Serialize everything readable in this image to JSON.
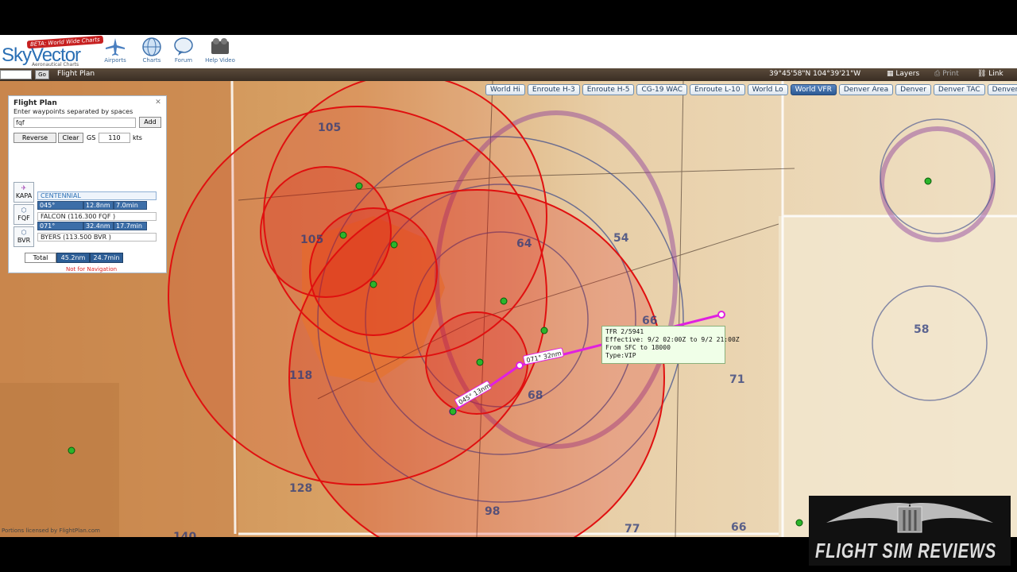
{
  "header": {
    "logo_text": "SkyVector",
    "logo_sub": "Aeronautical Charts",
    "beta_badge": "BETA: World Wide Charts",
    "nav": [
      {
        "label": "Airports"
      },
      {
        "label": "Charts"
      },
      {
        "label": "Forum"
      },
      {
        "label": "Help Video"
      }
    ]
  },
  "toolbar": {
    "go_label": "Go",
    "flight_plan_label": "Flight Plan",
    "coordinates": "39°45'58\"N 104°39'21\"W",
    "layers_label": "Layers",
    "print_label": "Print",
    "link_label": "Link"
  },
  "chart_tabs": [
    {
      "label": "World Hi",
      "active": false
    },
    {
      "label": "Enroute H-3",
      "active": false
    },
    {
      "label": "Enroute H-5",
      "active": false
    },
    {
      "label": "CG-19 WAC",
      "active": false
    },
    {
      "label": "Enroute L-10",
      "active": false
    },
    {
      "label": "World Lo",
      "active": false
    },
    {
      "label": "World VFR",
      "active": true
    },
    {
      "label": "Denver Area",
      "active": false
    },
    {
      "label": "Denver",
      "active": false
    },
    {
      "label": "Denver TAC",
      "active": false
    },
    {
      "label": "Denver FLY",
      "active": false
    }
  ],
  "flight_plan": {
    "title": "Flight Plan",
    "hint": "Enter waypoints separated by spaces",
    "input_value": "fqf",
    "add_label": "Add",
    "reverse_label": "Reverse",
    "clear_label": "Clear",
    "gs_label": "GS",
    "gs_value": "110",
    "kts_label": "kts",
    "waypoints": [
      {
        "id": "KAPA",
        "name": "CENTENNIAL",
        "kind": "airport"
      },
      {
        "id": "FQF",
        "name": "FALCON (116.300 FQF )",
        "kind": "vor"
      },
      {
        "id": "BVR",
        "name": "BYERS (113.500 BVR )",
        "kind": "vor"
      }
    ],
    "legs": [
      {
        "course": "045° (058°T)",
        "dist": "12.8nm",
        "time": "7.0min"
      },
      {
        "course": "071° (082°T)",
        "dist": "32.4nm",
        "time": "17.7min"
      }
    ],
    "total_label": "Total",
    "total_dist": "45.2nm",
    "total_time": "24.7min",
    "warning": "Not for Navigation"
  },
  "map": {
    "leg_label_1": "045° 13nm",
    "leg_label_2": "071° 32nm",
    "labels": [
      "105",
      "105",
      "64",
      "54",
      "118",
      "128",
      "140",
      "68",
      "66",
      "71",
      "58",
      "98",
      "77",
      "66"
    ],
    "tfr_tooltip": {
      "line1": "TFR 2/5941",
      "line2": "Effective: 9/2 02:00Z to 9/2 21:00Z",
      "line3": "From SFC to 18000",
      "line4": "Type:VIP"
    },
    "credit": "Portions licensed by FlightPlan.com",
    "colors": {
      "tfr_red": "#e01010",
      "route_magenta": "#e020e0",
      "terrain": "#d49a5c"
    }
  },
  "watermark": {
    "text": "FLIGHT SIM REVIEWS"
  }
}
